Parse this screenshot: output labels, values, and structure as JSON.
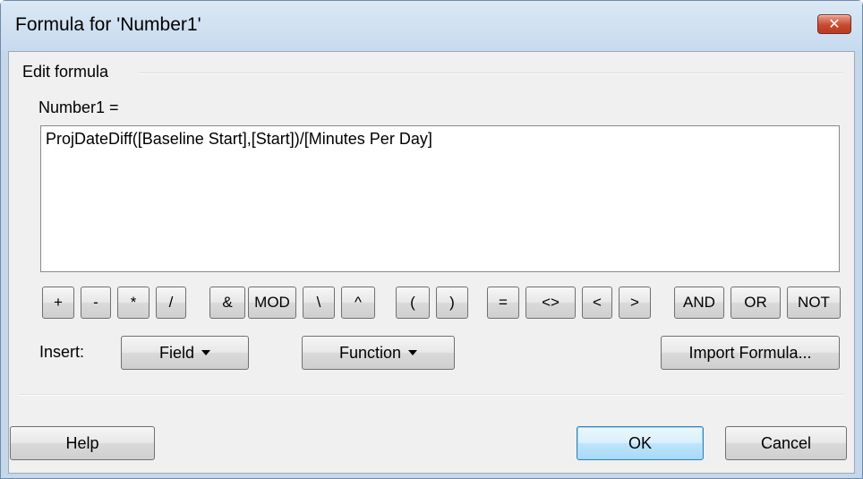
{
  "window": {
    "title": "Formula for 'Number1'"
  },
  "group": {
    "label": "Edit formula"
  },
  "field": {
    "label": "Number1 =",
    "formula": "ProjDateDiff([Baseline Start],[Start])/[Minutes Per Day]"
  },
  "operators": [
    "+",
    "-",
    "*",
    "/",
    "&",
    "MOD",
    "\\",
    "^",
    "(",
    ")",
    "=",
    "<>",
    "<",
    ">",
    "AND",
    "OR",
    "NOT"
  ],
  "insert": {
    "label": "Insert:",
    "field_button": "Field",
    "function_button": "Function",
    "import_button": "Import Formula..."
  },
  "footer": {
    "help": "Help",
    "ok": "OK",
    "cancel": "Cancel"
  },
  "icons": {
    "close": "close-icon"
  },
  "colors": {
    "close_button": "#c74a30",
    "ok_border": "#3c7fb1"
  }
}
